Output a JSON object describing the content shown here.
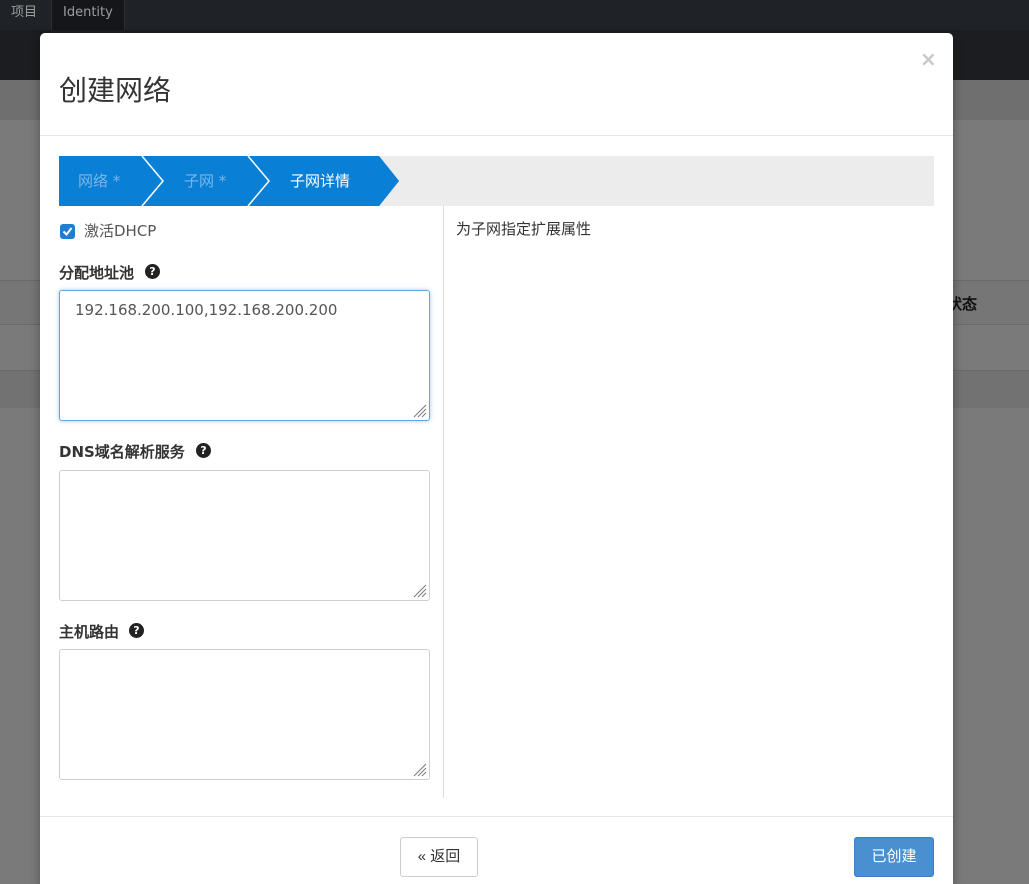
{
  "background": {
    "nav_tabs": [
      "项目",
      "Identity"
    ],
    "table_header_partial": "状态"
  },
  "modal": {
    "title": "创建网络",
    "close_symbol": "×",
    "wizard_steps": [
      {
        "label": "网络 *",
        "state": "done"
      },
      {
        "label": "子网 *",
        "state": "done"
      },
      {
        "label": "子网详情",
        "state": "active"
      }
    ],
    "form": {
      "dhcp_label": "激活DHCP",
      "dhcp_checked": true,
      "allocation_pools_label": "分配地址池",
      "allocation_pools_value": "192.168.200.100,192.168.200.200",
      "dns_label": "DNS域名解析服务",
      "dns_value": "",
      "host_routes_label": "主机路由",
      "host_routes_value": ""
    },
    "help_text": "为子网指定扩展属性",
    "buttons": {
      "back_label": "« 返回",
      "create_label": "已创建"
    }
  },
  "colors": {
    "accent": "#0a7fd6",
    "accent_light": "#7db6e6",
    "primary_button": "#4a90d0"
  }
}
